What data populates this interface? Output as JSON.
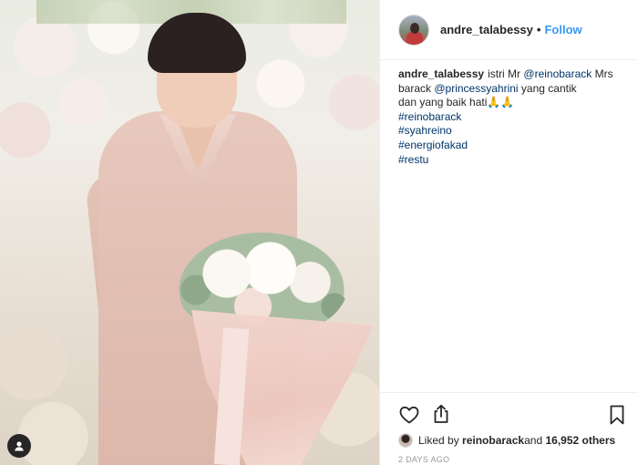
{
  "post": {
    "username": "andre_talabessy",
    "separator": "•",
    "follow_label": "Follow",
    "caption": {
      "username": "andre_talabessy",
      "segments": {
        "t1": "istri Mr ",
        "m1": "@reinobarack",
        "t2": " Mrs",
        "t3": "barack ",
        "m2": "@princessyahrini",
        "t4": " yang cantik",
        "t5": "dan yang baik hati🙏🙏"
      },
      "hashtags": [
        "#reinobarack",
        "#syahreino",
        "#energiofakad",
        "#restu"
      ]
    },
    "likes": {
      "prefix": "Liked by ",
      "liker": "reinobarack",
      "middle": " and ",
      "others": "16,952 others"
    },
    "timestamp": "2 DAYS AGO"
  },
  "icons": {
    "like": "heart-outline-icon",
    "share": "share-icon",
    "save": "bookmark-icon",
    "tagged_account": "user-icon"
  },
  "colors": {
    "link": "#003569",
    "follow": "#3897f0",
    "text": "#262626",
    "muted": "#999999"
  }
}
